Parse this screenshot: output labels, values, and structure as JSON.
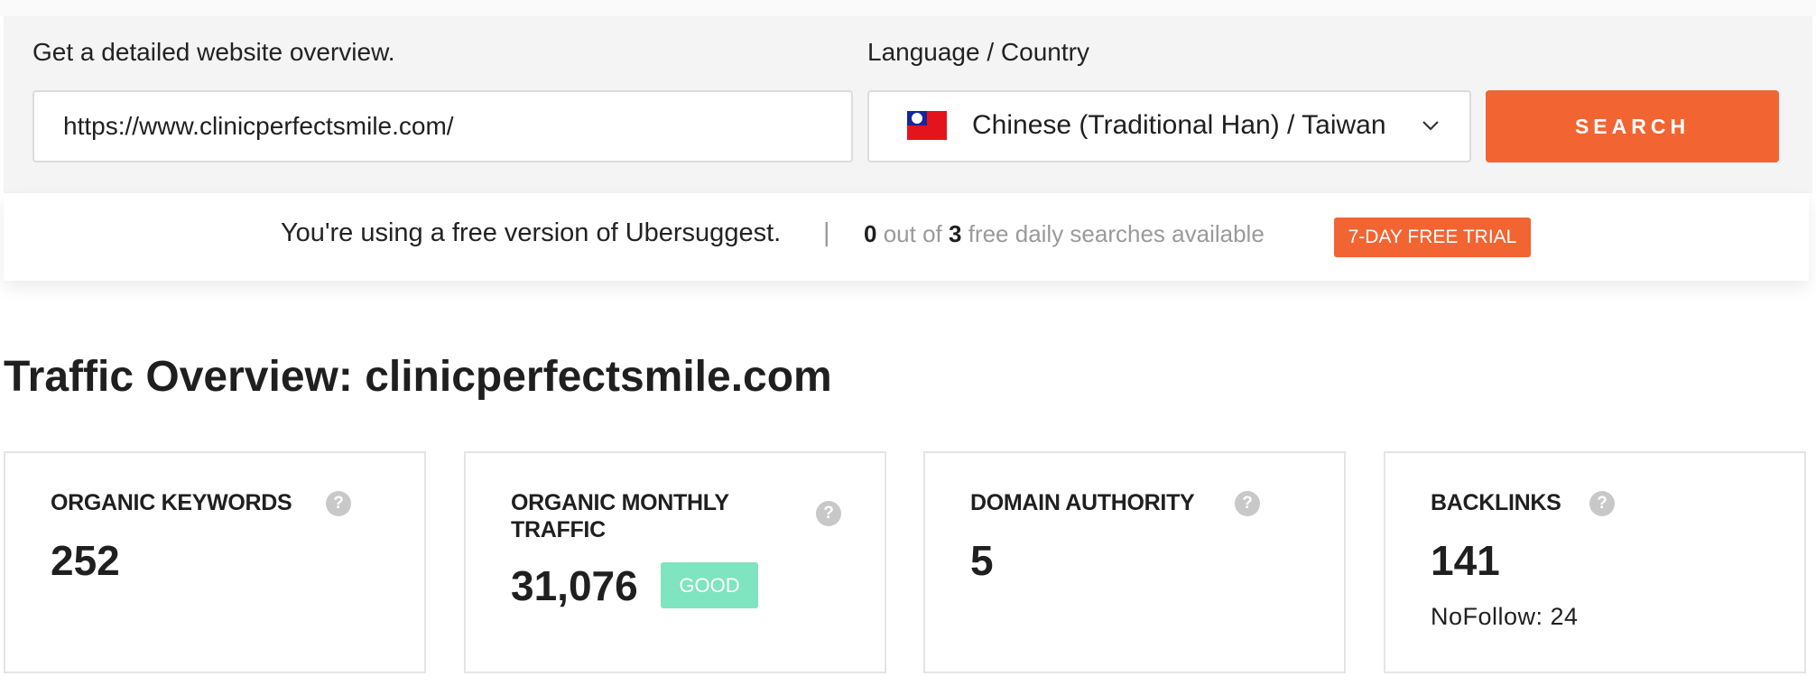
{
  "search": {
    "url_label": "Get a detailed website overview.",
    "url_value": "https://www.clinicperfectsmile.com/",
    "lang_label": "Language / Country",
    "lang_value": "Chinese (Traditional Han) / Taiwan",
    "button": "SEARCH"
  },
  "notice": {
    "text": "You're using a free version of Ubersuggest.",
    "separator": "|",
    "used": "0",
    "out_of": "out of",
    "total": "3",
    "suffix": "free daily searches available",
    "trial_button": "7-DAY FREE TRIAL"
  },
  "overview": {
    "title_strong": "Traffic Overview:",
    "domain": "clinicperfectsmile.com"
  },
  "cards": {
    "organic_keywords": {
      "label": "ORGANIC KEYWORDS",
      "value": "252"
    },
    "organic_traffic": {
      "label_line1": "ORGANIC MONTHLY",
      "label_line2": "TRAFFIC",
      "value": "31,076",
      "badge": "GOOD"
    },
    "domain_authority": {
      "label": "DOMAIN AUTHORITY",
      "value": "5"
    },
    "backlinks": {
      "label": "BACKLINKS",
      "value": "141",
      "nofollow": "NoFollow: 24"
    }
  },
  "help_glyph": "?",
  "icons": {
    "flag": "taiwan-flag-icon",
    "chevron": "chevron-down-icon",
    "help": "help-circle-icon"
  },
  "colors": {
    "accent": "#f26431",
    "good": "#7fe4c0",
    "panel": "#f4f4f4"
  }
}
